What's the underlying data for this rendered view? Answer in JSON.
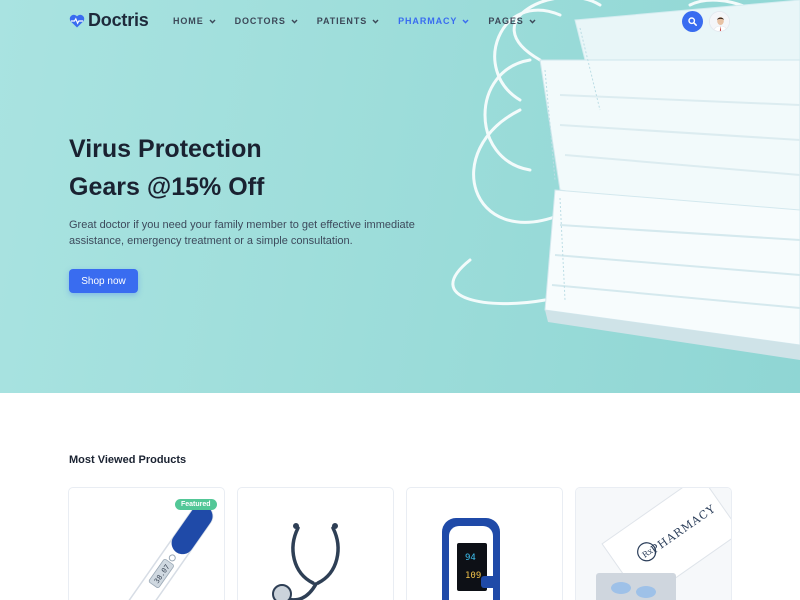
{
  "brand": {
    "name": "Doctris",
    "logo_icon": "heart-pulse-icon",
    "accent_color": "#396cf0"
  },
  "nav": {
    "items": [
      {
        "label": "HOME",
        "active": false
      },
      {
        "label": "DOCTORS",
        "active": false
      },
      {
        "label": "PATIENTS",
        "active": false
      },
      {
        "label": "PHARMACY",
        "active": true
      },
      {
        "label": "PAGES",
        "active": false
      }
    ],
    "search_icon": "search-icon",
    "avatar": "user-avatar"
  },
  "hero": {
    "title_line1": "Virus Protection",
    "title_line2": "Gears @15% Off",
    "description": "Great doctor if you need your family member to get effective immediate assistance, emergency treatment or a simple consultation.",
    "cta_label": "Shop now",
    "image": "surgical-masks"
  },
  "most_viewed": {
    "title": "Most Viewed Products",
    "products": [
      {
        "image": "digital-thermometer",
        "badge": "Featured",
        "display": "38.07"
      },
      {
        "image": "stethoscope",
        "badge": ""
      },
      {
        "image": "pulse-oximeter",
        "badge": "",
        "display_spo2": "94",
        "display_pr": "109"
      },
      {
        "image": "pharmacy-pill-box",
        "badge": "",
        "box_text": "PHARMACY"
      }
    ]
  }
}
